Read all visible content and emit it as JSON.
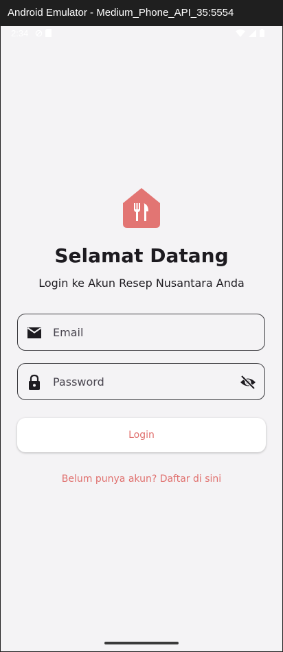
{
  "window": {
    "title": "Android Emulator - Medium_Phone_API_35:5554"
  },
  "statusbar": {
    "time": "2:34",
    "icons": [
      "block-icon",
      "sim-card-icon",
      "wifi-icon",
      "signal-icon",
      "battery-icon"
    ]
  },
  "app": {
    "logo_icon": "restaurant-home-icon",
    "title": "Selamat Datang",
    "subtitle": "Login ke Akun Resep Nusantara Anda",
    "email_field": {
      "placeholder": "Email",
      "value": "",
      "icon": "mail-icon"
    },
    "password_field": {
      "placeholder": "Password",
      "value": "",
      "icon": "lock-icon",
      "toggle_icon": "visibility-off-icon"
    },
    "login_button": "Login",
    "register_link": "Belum punya akun? Daftar di sini"
  },
  "colors": {
    "accent": "#e0706e",
    "background": "#f4f3f5",
    "text": "#1d1b20"
  }
}
